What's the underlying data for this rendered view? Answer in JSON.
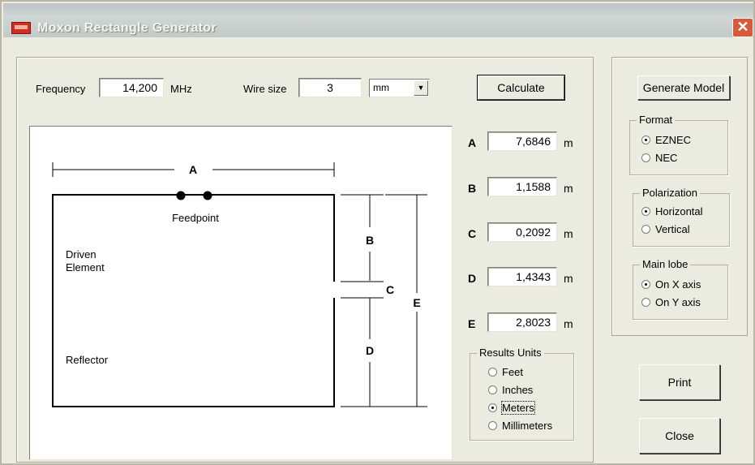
{
  "window": {
    "title": "Moxon Rectangle Generator",
    "close_glyph": "✕"
  },
  "inputs": {
    "frequency_label": "Frequency",
    "frequency_value": "14,200",
    "frequency_unit": "MHz",
    "wire_label": "Wire size",
    "wire_value": "3",
    "wire_unit_selected": "mm"
  },
  "buttons": {
    "calculate_underlined": "C",
    "calculate_rest": "alculate",
    "generate_underlined": "G",
    "generate_rest": "enerate Model",
    "print_underlined": "P",
    "print_rest": "rint",
    "close": "Close"
  },
  "diagram": {
    "label_a": "A",
    "label_b": "B",
    "label_c": "C",
    "label_d": "D",
    "label_e": "E",
    "feedpoint": "Feedpoint",
    "driven_1": "Driven",
    "driven_2": "Element",
    "reflector": "Reflector"
  },
  "results": [
    {
      "label": "A",
      "value": "7,6846",
      "unit": "m"
    },
    {
      "label": "B",
      "value": "1,1588",
      "unit": "m"
    },
    {
      "label": "C",
      "value": "0,2092",
      "unit": "m"
    },
    {
      "label": "D",
      "value": "1,4343",
      "unit": "m"
    },
    {
      "label": "E",
      "value": "2,8023",
      "unit": "m"
    }
  ],
  "results_units": {
    "title": "Results Units",
    "options": [
      "Feet",
      "Inches",
      "Meters",
      "Millimeters"
    ],
    "selected": "Meters"
  },
  "format": {
    "title": "Format",
    "options": [
      "EZNEC",
      "NEC"
    ],
    "selected": "EZNEC"
  },
  "polarization": {
    "title": "Polarization",
    "options": [
      "Horizontal",
      "Vertical"
    ],
    "selected": "Horizontal"
  },
  "main_lobe": {
    "title": "Main lobe",
    "options": [
      "On X axis",
      "On Y axis"
    ],
    "selected": "On X axis"
  },
  "colors": {
    "window_bg": "#ecebe0",
    "close_button": "#d75a3c",
    "app_icon": "#d62b1f"
  },
  "icons": {
    "app": "app-icon",
    "close": "close-icon",
    "dropdown": "dropdown-arrow-icon"
  }
}
